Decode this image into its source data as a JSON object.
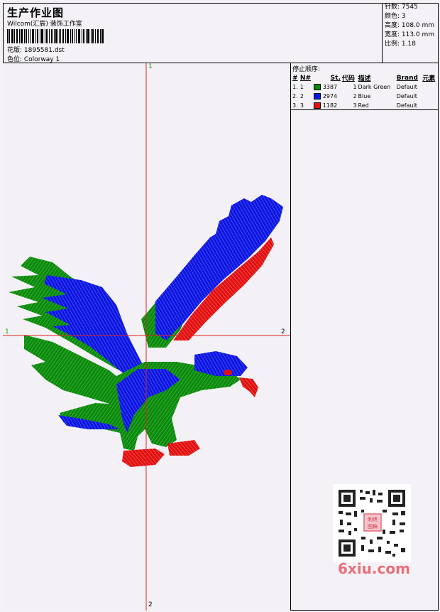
{
  "header": {
    "title": "生产作业图",
    "subtitle": "Wilcom(汇宸) 装饰工作室",
    "design_file": "花版: 1895581.dst",
    "colorway": "色位: Colorway 1"
  },
  "stats": {
    "stitches": "针数: 7545",
    "colors": "颜色: 3",
    "height": "高度: 108.0 mm",
    "width": "宽度: 113.0 mm",
    "scale": "比例: 1.18"
  },
  "color_sequence": {
    "title": "停止顺序:",
    "headers": [
      "#",
      "N#",
      "St.",
      "代码",
      "描述",
      "Brand",
      "元素"
    ],
    "rows": [
      {
        "num": "1.",
        "n": "1",
        "color": "#0a8a0a",
        "stitches": "3387",
        "code": "1",
        "desc": "Dark Green",
        "brand": "Default"
      },
      {
        "num": "2.",
        "n": "2",
        "color": "#0d16e0",
        "stitches": "2974",
        "code": "2",
        "desc": "Blue",
        "brand": "Default"
      },
      {
        "num": "3.",
        "n": "3",
        "color": "#e01010",
        "stitches": "1182",
        "code": "3",
        "desc": "Red",
        "brand": "Default"
      }
    ]
  },
  "axes": {
    "top": "1",
    "bottom": "2",
    "left": "1",
    "right": "2"
  },
  "watermark": "6xiu.com",
  "colors": {
    "green": "#0a8a0a",
    "blue": "#0d16e0",
    "red": "#e01010",
    "axis": "#e02020"
  }
}
